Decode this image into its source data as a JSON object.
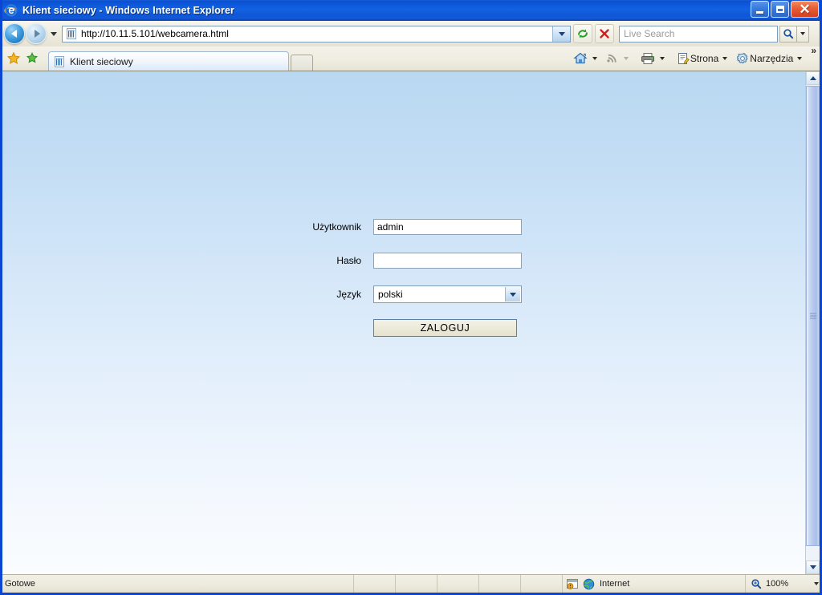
{
  "window": {
    "title": "Klient sieciowy - Windows Internet Explorer",
    "app_icon": "ie-logo-icon",
    "minimize_label": "Minimalizuj",
    "restore_label": "Przywróć",
    "close_label": "Zamknij"
  },
  "navigation": {
    "back_label": "Wstecz",
    "forward_label": "Dalej",
    "history_label": "Ostatnie strony",
    "url": "http://10.11.5.101/webcamera.html",
    "refresh_label": "Odśwież",
    "stop_label": "Zatrzymaj"
  },
  "search": {
    "placeholder": "Live Search",
    "value": "",
    "go_label": "Szukaj"
  },
  "tabs": {
    "favorites_label": "Ulubione",
    "add_favorite_label": "Dodaj do ulubionych",
    "items": [
      {
        "label": "Klient sieciowy",
        "icon": "page-icon",
        "active": true
      }
    ],
    "new_tab_label": "Nowa karta"
  },
  "command_bar": {
    "home_label": "Strona główna",
    "feeds_label": "Kanały informacyjne",
    "print_label": "Drukuj",
    "page_label": "Strona",
    "tools_label": "Narzędzia",
    "overflow_label": "»"
  },
  "page": {
    "background_top": "#b9d8f2",
    "background_bottom": "#fafcfe",
    "form": {
      "fields": [
        {
          "label": "Użytkownik",
          "type": "text",
          "value": "admin",
          "placeholder": ""
        },
        {
          "label": "Hasło",
          "type": "password",
          "value": "",
          "placeholder": ""
        },
        {
          "label": "Język",
          "type": "select",
          "value": "polski",
          "options": [
            "polski"
          ]
        }
      ],
      "submit_label": "ZALOGUJ"
    }
  },
  "scrollbar": {
    "scroll_up_label": "Przewiń w górę",
    "scroll_down_label": "Przewiń w dół"
  },
  "statusbar": {
    "status": "Gotowe",
    "zone": "Internet",
    "zone_icon": "globe-icon",
    "protected_icon": "protected-mode-icon",
    "zoom": "100%"
  }
}
